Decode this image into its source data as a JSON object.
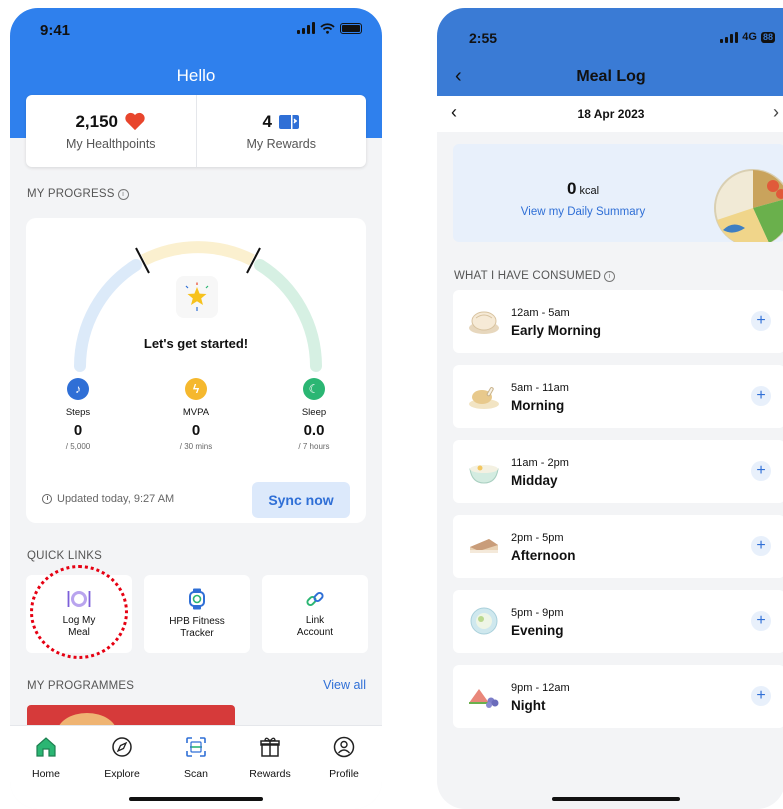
{
  "colors": {
    "brand_blue": "#2f80ed",
    "header_blue": "#3a7bd5",
    "link_blue": "#2f6fd6",
    "heart_red": "#e8452c",
    "highlight_red": "#e60012"
  },
  "home": {
    "status_time": "9:41",
    "title": "Hello",
    "healthpoints": {
      "value": "2,150",
      "label": "My Healthpoints",
      "icon": "heart-icon"
    },
    "rewards": {
      "value": "4",
      "label": "My Rewards",
      "icon": "ticket-icon"
    },
    "progress_label": "MY PROGRESS",
    "info_glyph": "i",
    "progress_message": "Let's get started!",
    "metrics": [
      {
        "label": "Steps",
        "value": "0",
        "target": "/ 5,000",
        "color": "#2f6fd6",
        "icon": "footsteps-icon"
      },
      {
        "label": "MVPA",
        "value": "0",
        "target": "/ 30 mins",
        "color": "#f5b82e",
        "icon": "lightning-icon"
      },
      {
        "label": "Sleep",
        "value": "0.0",
        "target": "/ 7 hours",
        "color": "#2bb673",
        "icon": "moon-icon"
      }
    ],
    "updated_text": "Updated today, 9:27 AM",
    "sync_label": "Sync now",
    "quick_links_label": "QUICK LINKS",
    "quick_links": [
      {
        "label": "Log My\nMeal",
        "icon": "plate-icon"
      },
      {
        "label": "HPB Fitness\nTracker",
        "icon": "watch-icon"
      },
      {
        "label": "Link\nAccount",
        "icon": "link-icon"
      }
    ],
    "programmes_label": "MY PROGRAMMES",
    "view_all": "View all",
    "tabs": [
      {
        "label": "Home",
        "icon": "home-icon"
      },
      {
        "label": "Explore",
        "icon": "compass-icon"
      },
      {
        "label": "Scan",
        "icon": "scan-icon"
      },
      {
        "label": "Rewards",
        "icon": "gift-icon"
      },
      {
        "label": "Profile",
        "icon": "profile-icon"
      }
    ]
  },
  "meal_log": {
    "status_time": "2:55",
    "network": "4G",
    "battery": "88",
    "title": "Meal Log",
    "back_glyph": "‹",
    "prev_glyph": "‹",
    "next_glyph": "›",
    "date": "18 Apr 2023",
    "kcal_value": "0",
    "kcal_unit": "kcal",
    "summary_link": "View my Daily Summary",
    "consumed_label": "WHAT I HAVE CONSUMED",
    "plus_glyph": "+",
    "meals": [
      {
        "time": "12am - 5am",
        "name": "Early Morning",
        "icon": "dumpling-icon"
      },
      {
        "time": "5am - 11am",
        "name": "Morning",
        "icon": "drumstick-icon"
      },
      {
        "time": "11am - 2pm",
        "name": "Midday",
        "icon": "bowl-icon"
      },
      {
        "time": "2pm - 5pm",
        "name": "Afternoon",
        "icon": "cake-icon"
      },
      {
        "time": "5pm - 9pm",
        "name": "Evening",
        "icon": "salad-plate-icon"
      },
      {
        "time": "9pm - 12am",
        "name": "Night",
        "icon": "fruit-icon"
      }
    ]
  }
}
